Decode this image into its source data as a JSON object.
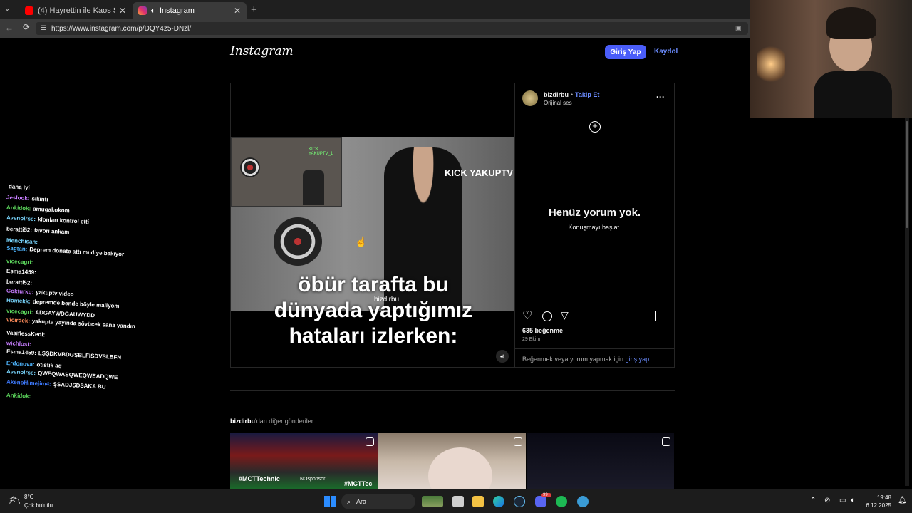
{
  "browser": {
    "tabs": [
      {
        "title": "(4) Hayrettin ile Kaos Show - 2.Se",
        "icon": "youtube-icon",
        "active": false
      },
      {
        "title": "Instagram",
        "icon": "instagram-icon",
        "active": true
      }
    ],
    "url": "https://www.instagram.com/p/DQY4z5-DNzl/"
  },
  "instagram": {
    "logo": "Instagram",
    "login_label": "Giriş Yap",
    "signup_label": "Kaydol",
    "post": {
      "username": "bizdirbu",
      "follow_label": "Takip Et",
      "audio": "Orijinal ses",
      "overlay_watermark": "KICK YAKUPTV",
      "small_watermark": "KICK YAKUPTV_1",
      "caption_lines": [
        "öbür tarafta bu",
        "dünyada yaptığımız",
        "hataları izlerken:"
      ],
      "caption_handle": "bizdirbu",
      "no_comments_title": "Henüz yorum yok.",
      "no_comments_sub": "Konuşmayı başlat.",
      "likes": "635 beğenme",
      "date": "29 Ekim",
      "login_prompt_prefix": "Beğenmek veya yorum yapmak için",
      "login_prompt_link": "giriş yap",
      "login_prompt_suffix": "."
    },
    "more_posts": {
      "user": "bizdirbu",
      "suffix": "'dan diğer gönderiler",
      "thumb1_text": "#MCTTechnic",
      "thumb1_text2": "#MCTTec",
      "thumb1_text3": "NOsponsor"
    }
  },
  "chat": [
    {
      "user": "",
      "msg": "daha iyi",
      "color": "#ffffff"
    },
    {
      "user": "Jeslook:",
      "msg": "sıkıntı",
      "color": "#c77dff"
    },
    {
      "user": "Ankidok:",
      "msg": "amugakokom",
      "color": "#5cd65c"
    },
    {
      "user": "Avenoirse:",
      "msg": "klonları kontrol etti",
      "color": "#7ad7ff"
    },
    {
      "user": "beratti52:",
      "msg": "favori ankam",
      "color": "#ffffff"
    },
    {
      "user": "Menchisan:",
      "msg": "",
      "color": "#7ad7ff"
    },
    {
      "user": "Sagtan:",
      "msg": "Deprem donate attı mı diye bakıyor",
      "color": "#4fb6ff"
    },
    {
      "user": "vicecagri:",
      "msg": "",
      "color": "#5cd65c"
    },
    {
      "user": "Esma1459:",
      "msg": "",
      "color": "#ffffff"
    },
    {
      "user": "beratti52:",
      "msg": "",
      "color": "#ffffff"
    },
    {
      "user": "Gokturkq:",
      "msg": "yakuptv video",
      "color": "#c77dff"
    },
    {
      "user": "Homekk:",
      "msg": "depremde bende böyle maliyom",
      "color": "#7ad7ff"
    },
    {
      "user": "vicecagri:",
      "msg": "ADGAYWDGAUWYDD",
      "color": "#5cd65c"
    },
    {
      "user": "vicirdek:",
      "msg": "yakuptv yayında sövücek sana yandın",
      "color": "#ff8c5a"
    },
    {
      "user": "VasiflessKedi:",
      "msg": "",
      "color": "#ffffff"
    },
    {
      "user": "wichlost:",
      "msg": "",
      "color": "#c77dff"
    },
    {
      "user": "Esma1459:",
      "msg": "LŞŞDKVBDGŞBLFİSDVSLBFN",
      "color": "#ffffff"
    },
    {
      "user": "Erdonova:",
      "msg": "otistik aq",
      "color": "#4fb6ff"
    },
    {
      "user": "Avenoirse:",
      "msg": "QWEQWASQWEQWEADQWE",
      "color": "#7ad7ff"
    },
    {
      "user": "AkenoHimejim4:",
      "msg": "ŞSADJŞDSAKA BU",
      "color": "#3e7bff"
    },
    {
      "user": "Ankidok:",
      "msg": "",
      "color": "#5cd65c"
    }
  ],
  "taskbar": {
    "weather_temp": "8°C",
    "weather_desc": "Çok bulutlu",
    "search_label": "Ara",
    "time": "19:48",
    "date": "6.12.2025",
    "badge": "99+"
  },
  "colors": {
    "accent": "#4a5df9",
    "link": "#6b8cff"
  }
}
